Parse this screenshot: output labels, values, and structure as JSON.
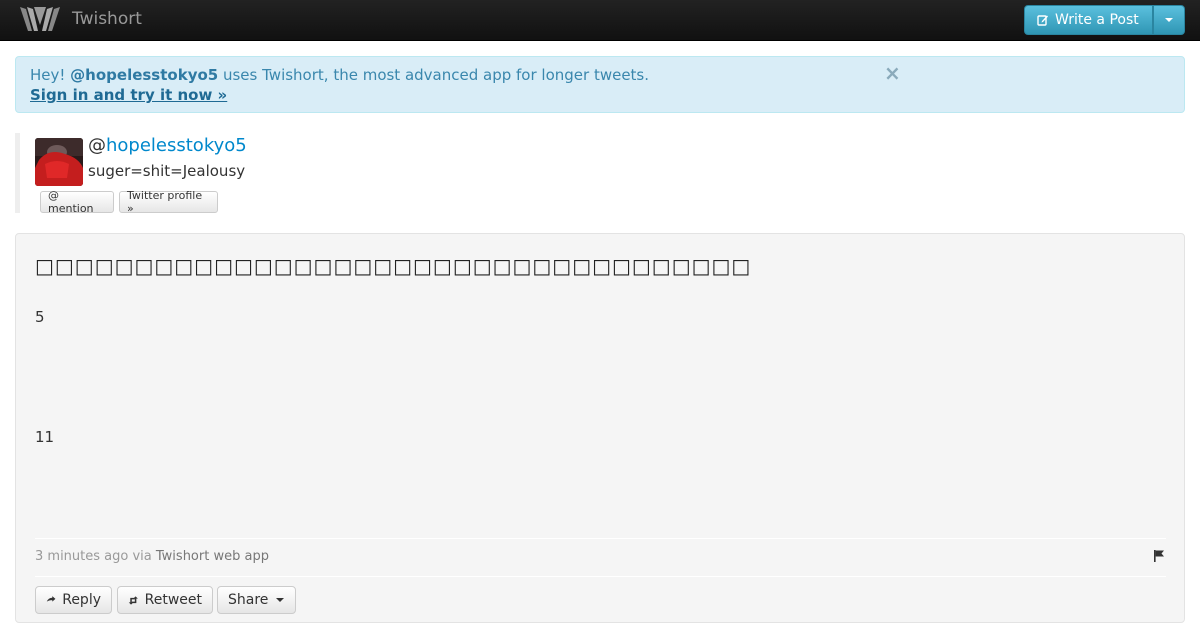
{
  "navbar": {
    "brand": "Twishort",
    "write_label": "Write a Post"
  },
  "alert": {
    "prefix": "Hey! ",
    "username": "@hopelesstokyo5",
    "suffix": " uses Twishort, the most advanced app for longer tweets.",
    "link_label": "Sign in and try it now »",
    "close_label": "×"
  },
  "profile": {
    "at": "@",
    "username": "hopelesstokyo5",
    "bio": "suger=shit=Jealousy",
    "mention_label": "@ mention",
    "twitter_profile_label": "Twitter profile »"
  },
  "post": {
    "title": "□□□□□□□□□□□□□□□□□□□□□□□□□□□□□□□□□□□□",
    "line_1": "5",
    "line_2": "11",
    "time_ago": "3 minutes ago",
    "via": " via ",
    "app": "Twishort web app",
    "reply_label": "Reply",
    "retweet_label": "Retweet",
    "share_label": "Share"
  },
  "colors": {
    "navbar_bg": "#1b1b1b",
    "accent": "#2f96b4",
    "alert_bg": "#d9edf7",
    "link": "#0088cc"
  },
  "icons": {
    "brand": "twishort-logo",
    "write": "edit-icon",
    "close": "close-icon",
    "reply": "reply-arrow-icon",
    "retweet": "retweet-icon",
    "flag": "flag-icon"
  }
}
